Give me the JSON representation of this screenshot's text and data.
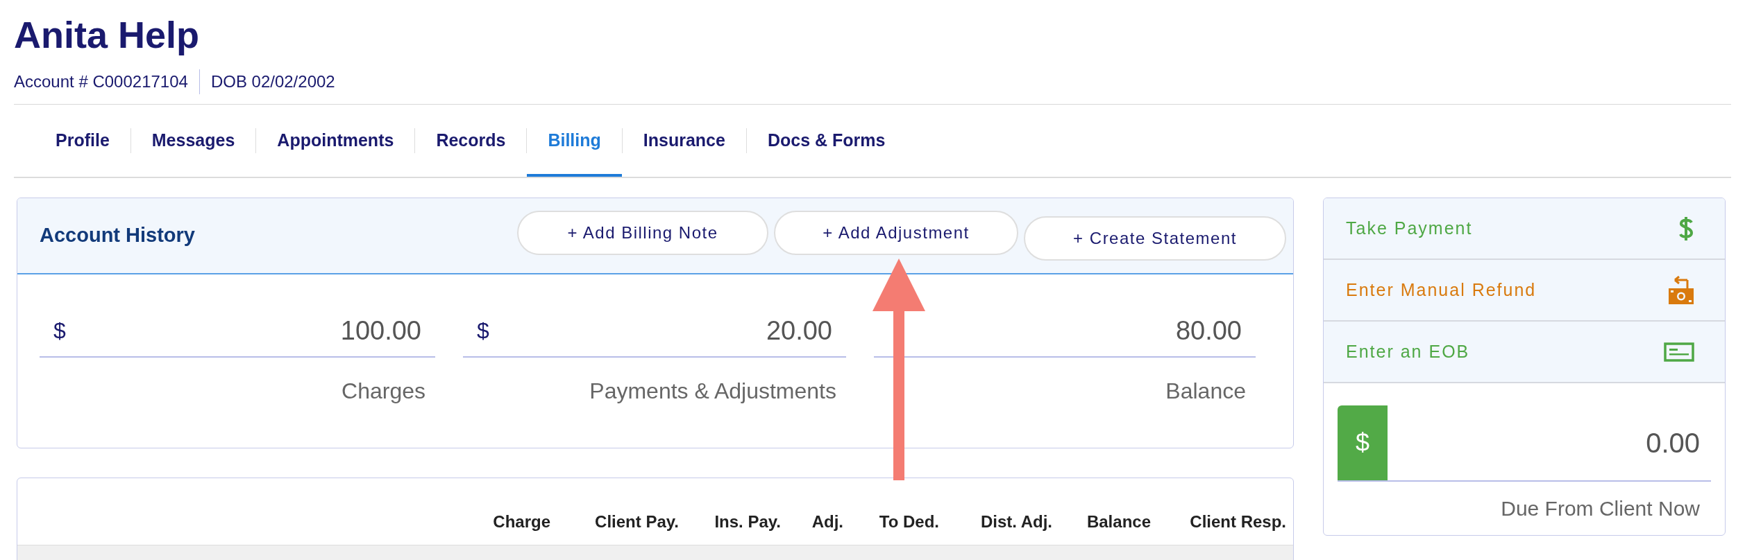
{
  "patient": {
    "name": "Anita Help",
    "account": "Account # C000217104",
    "dob": "DOB 02/02/2002"
  },
  "tabs": [
    {
      "label": "Profile",
      "selected": false
    },
    {
      "label": "Messages",
      "selected": false
    },
    {
      "label": "Appointments",
      "selected": false
    },
    {
      "label": "Records",
      "selected": false
    },
    {
      "label": "Billing",
      "selected": true
    },
    {
      "label": "Insurance",
      "selected": false
    },
    {
      "label": "Docs & Forms",
      "selected": false
    }
  ],
  "account_history": {
    "title": "Account History",
    "buttons": [
      "+ Add Billing Note",
      "+ Add Adjustment",
      "+ Create Statement"
    ],
    "totals": [
      {
        "currency": "$",
        "amount": "100.00",
        "label": "Charges"
      },
      {
        "currency": "$",
        "amount": "20.00",
        "label": "Payments & Adjustments"
      },
      {
        "amount": "80.00",
        "label": "Balance"
      }
    ]
  },
  "actions": [
    {
      "label": "Take Payment",
      "kind": "dollar",
      "color": "#4fa845"
    },
    {
      "label": "Enter Manual Refund",
      "kind": "refund",
      "color": "#d97a0e"
    },
    {
      "label": "Enter an EOB",
      "kind": "check",
      "color": "#4fa845"
    }
  ],
  "due": {
    "currency": "$",
    "value": "0.00",
    "label": "Due From Client Now"
  },
  "table": {
    "columns": [
      "Charge",
      "Client Pay.",
      "Ins. Pay.",
      "Adj.",
      "To Ded.",
      "Dist. Adj.",
      "Balance",
      "Client Resp."
    ]
  },
  "annotation": {
    "kind": "arrow"
  }
}
